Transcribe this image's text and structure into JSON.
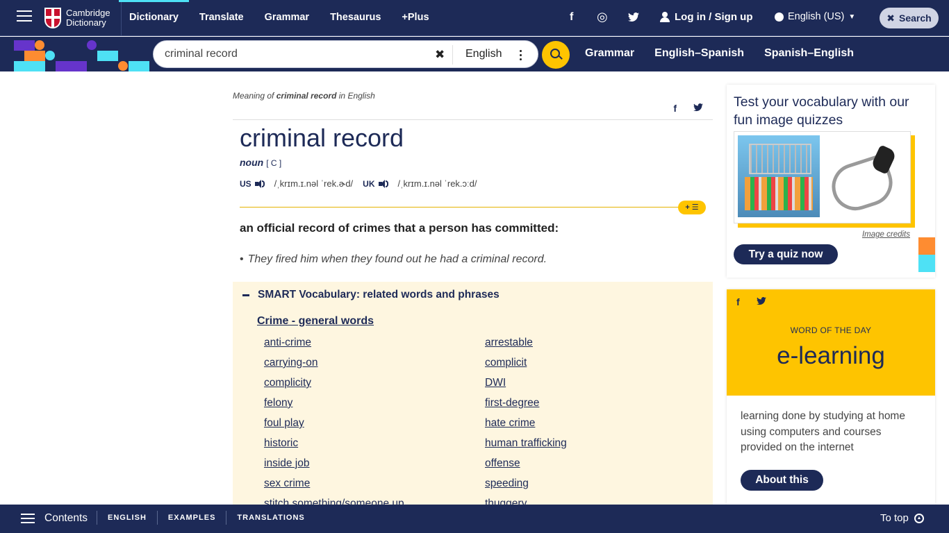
{
  "header": {
    "logo_line1": "Cambridge",
    "logo_line2": "Dictionary",
    "nav": [
      "Dictionary",
      "Translate",
      "Grammar",
      "Thesaurus",
      "+Plus"
    ],
    "login": "Log in / Sign up",
    "language": "English (US)",
    "search_label": "Search"
  },
  "search": {
    "query": "criminal record",
    "dictionary": "English",
    "quick_links": [
      "Grammar",
      "English–Spanish",
      "Spanish–English"
    ]
  },
  "entry": {
    "meaning_prefix": "Meaning of",
    "meaning_word": "criminal record",
    "meaning_suffix": "in English",
    "headword": "criminal record",
    "pos": "noun",
    "grammar": "[ C ]",
    "us_label": "US",
    "us_ipa": "/ˌkrɪm.ɪ.nəl ˈrek.ɚd/",
    "uk_label": "UK",
    "uk_ipa": "/ˌkrɪm.ɪ.nəl ˈrek.ɔːd/",
    "plus_list": "+ ☰",
    "definition": "an official record of crimes that a person has committed:",
    "example": "They fired him when they found out he had a criminal record."
  },
  "smart_vocab": {
    "title": "SMART Vocabulary: related words and phrases",
    "topic": "Crime - general words",
    "left": [
      "anti-crime",
      "carrying-on",
      "complicity",
      "felony",
      "foul play",
      "historic",
      "inside job",
      "sex crime",
      "stitch something/someone up"
    ],
    "right": [
      "arrestable",
      "complicit",
      "DWI",
      "first-degree",
      "hate crime",
      "human trafficking",
      "offense",
      "speeding",
      "thuggery"
    ]
  },
  "quiz": {
    "title": "Test your vocabulary with our fun image quizzes",
    "credits": "Image credits",
    "button": "Try a quiz now"
  },
  "wotd": {
    "label": "WORD OF THE DAY",
    "word": "e-learning",
    "definition": "learning done by studying at home using computers and courses provided on the internet",
    "button": "About this"
  },
  "footer": {
    "contents": "Contents",
    "tabs": [
      "ENGLISH",
      "EXAMPLES",
      "TRANSLATIONS"
    ],
    "to_top": "To top"
  },
  "icons": {
    "facebook": "f",
    "twitter": "🐦",
    "instagram": "◎",
    "clear": "✖",
    "search": "✖"
  },
  "colors": {
    "brand_navy": "#1d2a57",
    "accent_yellow": "#fec400",
    "cyan": "#4ee1f5",
    "orange": "#fe8c31",
    "purple": "#6634cb",
    "smart_bg": "#fef6e0"
  }
}
